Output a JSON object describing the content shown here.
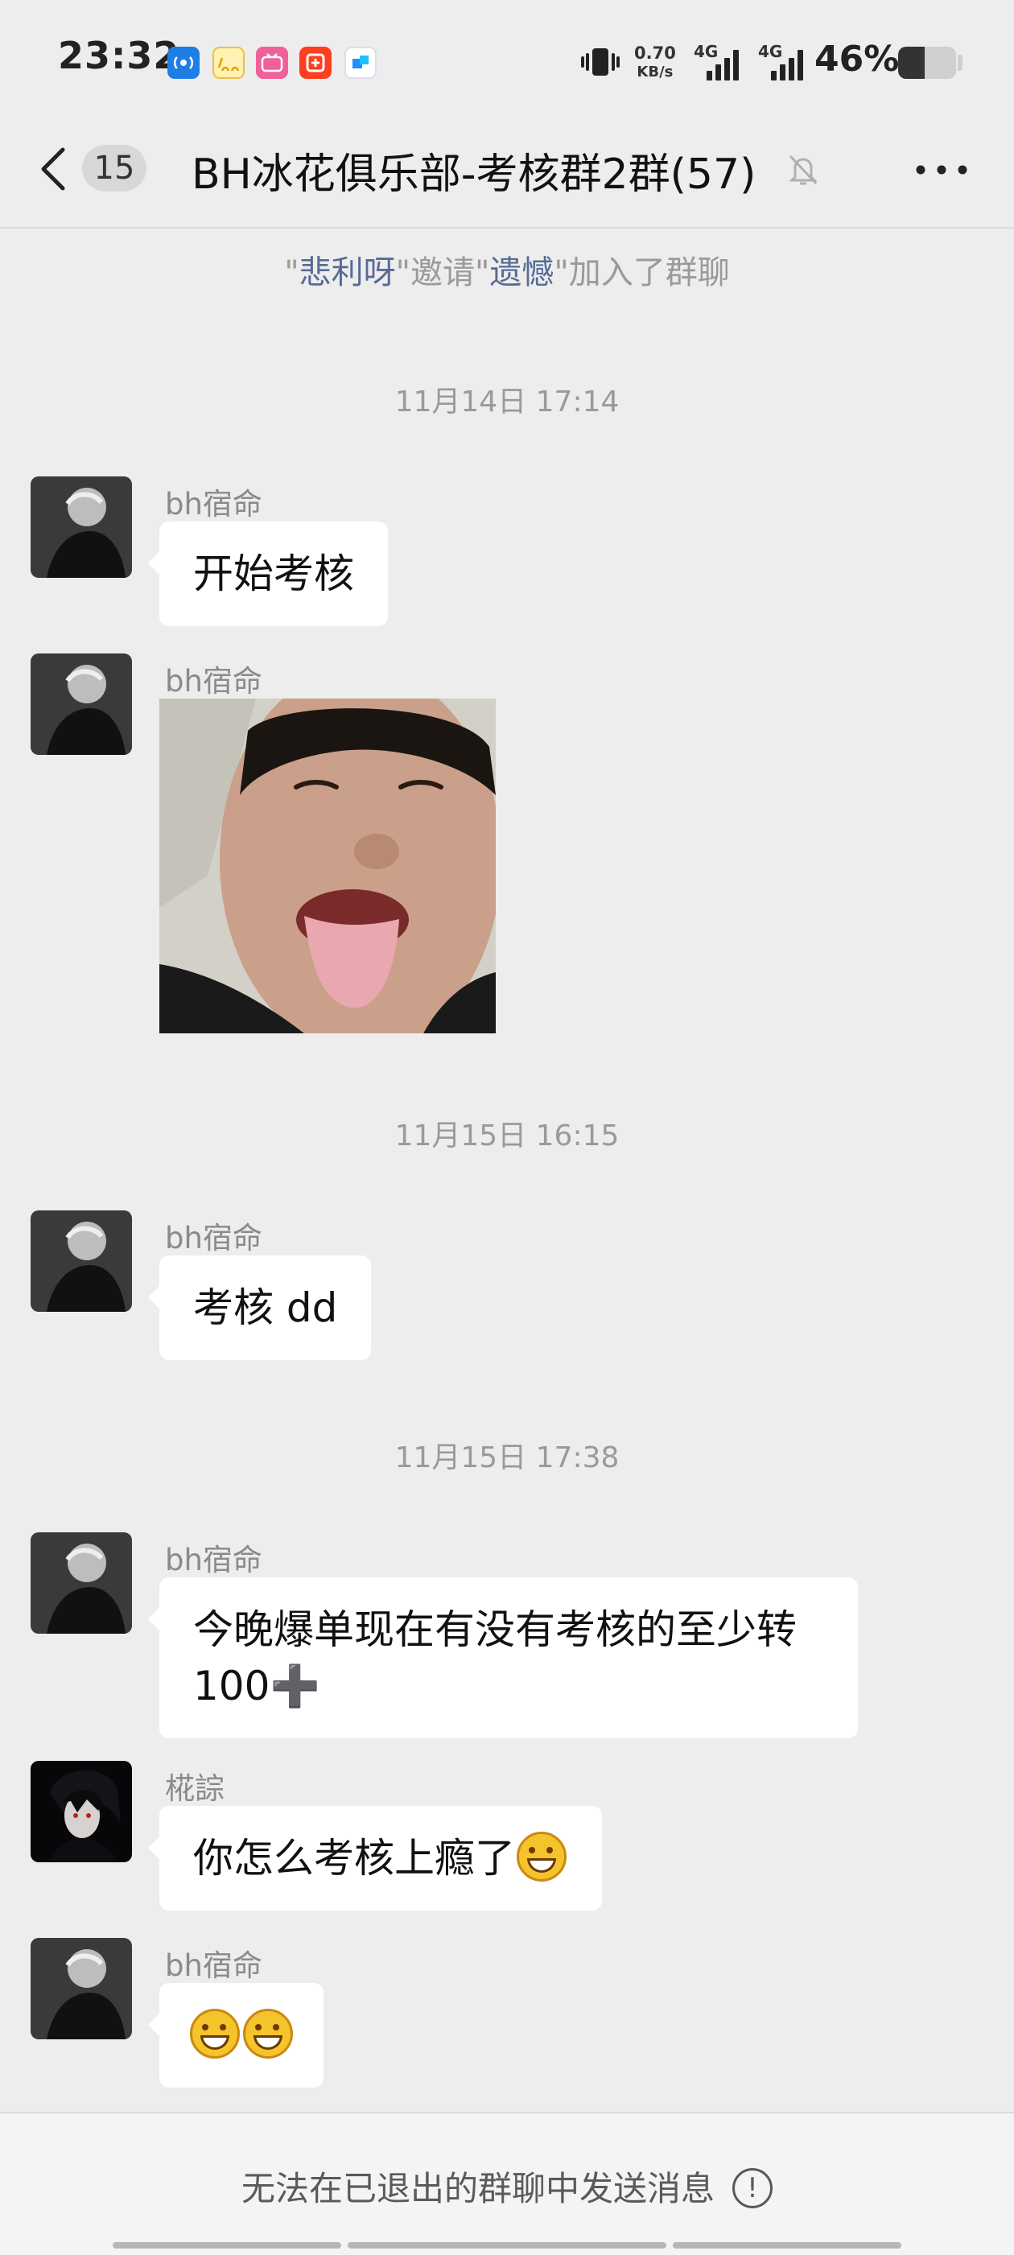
{
  "status_bar": {
    "time": "23:32",
    "net_speed_value": "0.70",
    "net_speed_unit": "KB/s",
    "signal1_label": "4G",
    "signal2_label": "4G",
    "battery_percent": "46%",
    "battery_level": 0.46,
    "app_icons": [
      "broadcast-icon",
      "100-icon",
      "bilibili-icon",
      "taobao-icon",
      "app-icon"
    ]
  },
  "header": {
    "back_label": "<",
    "unread_count": "15",
    "title": "BH冰花俱乐部-考核群2群(57)",
    "more_label": "···"
  },
  "system_notice": {
    "q1": "\"",
    "inviter": "悲利呀",
    "mid": "\"邀请\"",
    "invitee": "遗憾",
    "tail": "\"加入了群聊"
  },
  "dividers": [
    "11月14日 17:14",
    "11月15日 16:15",
    "11月15日 17:38"
  ],
  "messages": [
    {
      "sender": "bh宿命",
      "text": "开始考核"
    },
    {
      "sender": "bh宿命",
      "text": ""
    },
    {
      "sender": "bh宿命",
      "text": "考核 dd"
    },
    {
      "sender": "bh宿命",
      "line1": "今晚爆单现在有没有考核的至少转",
      "line2": "100",
      "plus": "➕"
    },
    {
      "sender": "椛誴",
      "text": "你怎么考核上瘾了"
    },
    {
      "sender": "bh宿命",
      "text": ""
    }
  ],
  "bottom": {
    "text": "无法在已退出的群聊中发送消息",
    "info_glyph": "!"
  },
  "colors": {
    "background": "#ededed",
    "link_name": "#576b95",
    "bubble": "#ffffff"
  }
}
